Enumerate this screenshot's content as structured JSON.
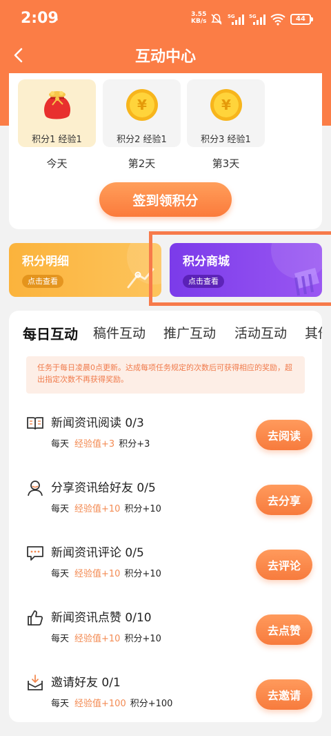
{
  "status": {
    "time": "2:09",
    "speed_value": "3.55",
    "speed_unit": "KB/s",
    "battery": "44"
  },
  "header": {
    "title": "互动中心"
  },
  "checkin": {
    "days": [
      {
        "reward": "积分1 经验1",
        "label": "今天",
        "icon": "red-gift-bag-icon",
        "active": true
      },
      {
        "reward": "积分2 经验1",
        "label": "第2天",
        "icon": "gold-coin-icon",
        "active": false
      },
      {
        "reward": "积分3 经验1",
        "label": "第3天",
        "icon": "gold-coin-icon",
        "active": false
      }
    ],
    "button_label": "签到领积分"
  },
  "promos": [
    {
      "title": "积分明细",
      "button": "点击查看",
      "color": "#fbb33c"
    },
    {
      "title": "积分商城",
      "button": "点击查看",
      "color": "#7b3bea"
    }
  ],
  "tabs": [
    "每日互动",
    "稿件互动",
    "推广互动",
    "活动互动",
    "其他"
  ],
  "notice": "任务于每日凌晨0点更新。达成每项任务规定的次数后可获得相应的奖励，超出指定次数不再获得奖励。",
  "tasks": [
    {
      "name": "新闻资讯阅读",
      "progress": "0/3",
      "freq": "每天",
      "exp": "经验值+3",
      "points": "积分+3",
      "button": "去阅读",
      "icon": "book-icon"
    },
    {
      "name": "分享资讯给好友",
      "progress": "0/5",
      "freq": "每天",
      "exp": "经验值+10",
      "points": "积分+10",
      "button": "去分享",
      "icon": "share-user-icon"
    },
    {
      "name": "新闻资讯评论",
      "progress": "0/5",
      "freq": "每天",
      "exp": "经验值+10",
      "points": "积分+10",
      "button": "去评论",
      "icon": "comment-icon"
    },
    {
      "name": "新闻资讯点赞",
      "progress": "0/10",
      "freq": "每天",
      "exp": "经验值+10",
      "points": "积分+10",
      "button": "去点赞",
      "icon": "thumbs-up-icon"
    },
    {
      "name": "邀请好友",
      "progress": "0/1",
      "freq": "每天",
      "exp": "经验值+100",
      "points": "积分+100",
      "button": "去邀请",
      "icon": "invite-mail-icon"
    }
  ],
  "colors": {
    "accent": "#fb7d46",
    "exp_text": "#f38a52",
    "mall_purple": "#7b3bea",
    "detail_yellow": "#fbb33c"
  }
}
